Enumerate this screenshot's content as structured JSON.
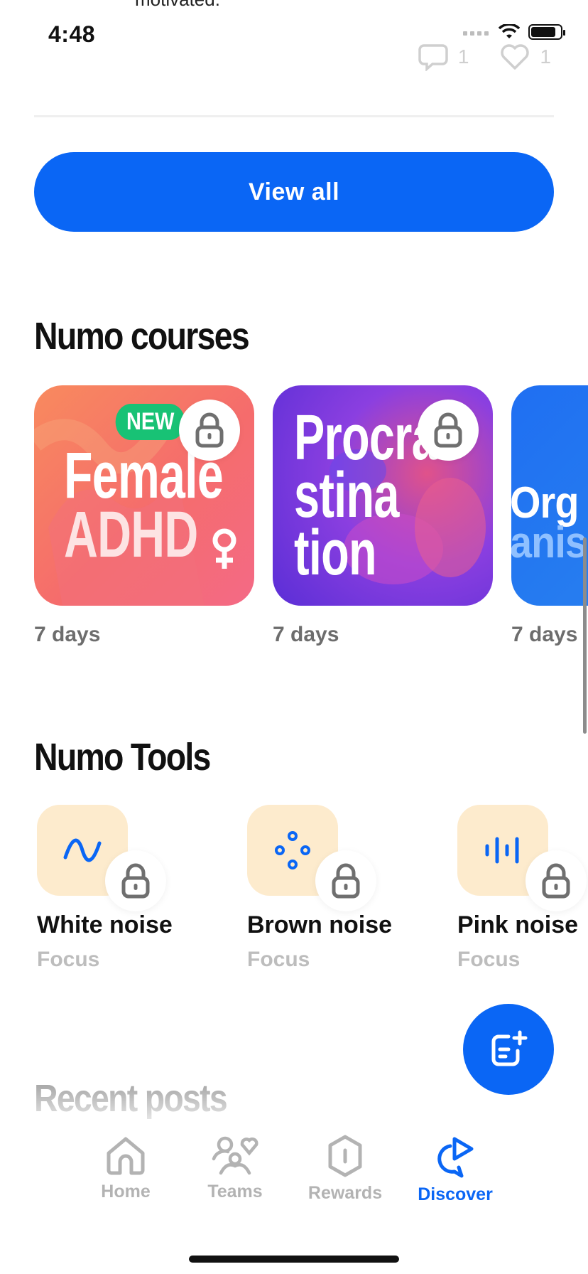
{
  "status_bar": {
    "time": "4:48",
    "cut_text": "motivated."
  },
  "post_stats": {
    "comments": "1",
    "likes": "1"
  },
  "view_all_label": "View all",
  "courses_section": {
    "title": "Numo courses",
    "courses": [
      {
        "title_lines": [
          "Female",
          "ADHD"
        ],
        "badge": "NEW",
        "duration": "7 days"
      },
      {
        "title_lines": [
          "Procra",
          "stina",
          "tion"
        ],
        "duration": "7 days"
      },
      {
        "title_lines": [
          "Org",
          "anis"
        ],
        "duration": "7 days"
      }
    ]
  },
  "tools_section": {
    "title": "Numo Tools",
    "tools": [
      {
        "name": "White noise",
        "category": "Focus",
        "icon": "sine-wave-icon"
      },
      {
        "name": "Brown noise",
        "category": "Focus",
        "icon": "dots-pattern-icon"
      },
      {
        "name": "Pink noise",
        "category": "Focus",
        "icon": "audio-bars-icon"
      }
    ]
  },
  "recent_posts_title": "Recent posts",
  "tabs": [
    {
      "label": "Home",
      "icon": "home-icon"
    },
    {
      "label": "Teams",
      "icon": "teams-icon"
    },
    {
      "label": "Rewards",
      "icon": "rewards-icon"
    },
    {
      "label": "Discover",
      "icon": "discover-icon",
      "active": true
    }
  ],
  "colors": {
    "accent": "#0a66f5",
    "badge_green": "#18c275",
    "tool_bg": "#fdebcd"
  }
}
